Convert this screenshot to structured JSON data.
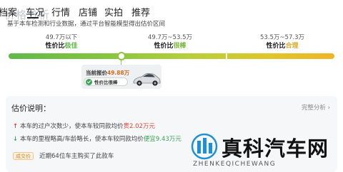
{
  "page": {
    "title": "价格分析"
  },
  "nav": {
    "items": [
      "档案",
      "车况",
      "行情",
      "店铺",
      "实拍",
      "推荐"
    ],
    "active_index": 1
  },
  "subtitle": "基于本车检测和行业数据，通过平台智能模型得出估价区间",
  "price_levels": [
    {
      "range": "49.7万以下",
      "prefix": "性价比",
      "label": "极佳",
      "color": "#5fb94a"
    },
    {
      "range": "49.7万~53.5万",
      "prefix": "性价比",
      "label": "很棒",
      "color": "#7ab83a"
    },
    {
      "range": "53.5万~57.3万",
      "prefix": "性价比",
      "label": "合理",
      "color": "#e0a92a"
    }
  ],
  "gauge": {
    "current_fraction": 0.345
  },
  "current_price": {
    "prefix": "当前报价",
    "value": "49.88万",
    "tag": "性价比很棒"
  },
  "explain": {
    "title": "估价说明：",
    "link": "完整分析 ›",
    "rows": [
      {
        "direction": "up",
        "text_before": "本车的过户次数少，使本车较同款均价",
        "highlight": "贵2.02万元",
        "text_after": ""
      },
      {
        "direction": "down",
        "text_before": "本车的里程略高/车龄略长，使本车较同款均价",
        "highlight": "便宜9.43万元",
        "text_after": ""
      }
    ],
    "deal_badge": "成交价",
    "deal_text": "近期64位车主购买了此款车"
  },
  "watermark": {
    "title": "真科汽车网",
    "subtitle": "ZHENKEQICHEWANG"
  },
  "colors": {
    "green": "#3aa655",
    "red": "#e1453a",
    "orange": "#d86a1c"
  }
}
